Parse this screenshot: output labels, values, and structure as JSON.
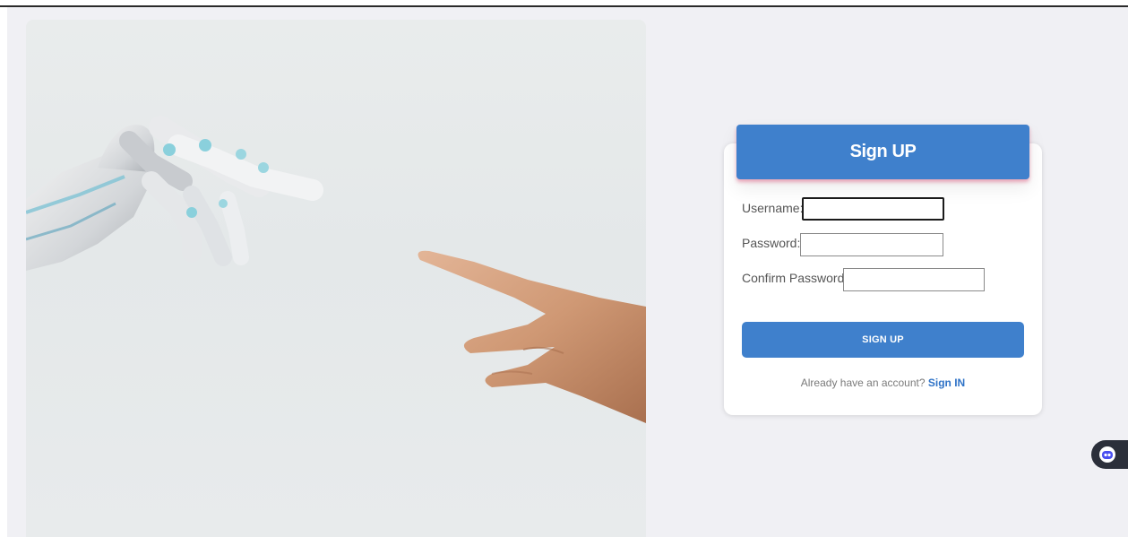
{
  "signup_card": {
    "title": "Sign UP",
    "fields": {
      "username": {
        "label": "Username:",
        "value": ""
      },
      "password": {
        "label": "Password:",
        "value": ""
      },
      "confirm_password": {
        "label": "Confirm Password:",
        "value": ""
      }
    },
    "submit_label": "SIGN UP",
    "footer_text": "Already have an account?",
    "signin_link": "Sign IN"
  },
  "hero_image": {
    "subject": "robot-hand-and-human-hand"
  },
  "assistant_widget": {
    "icon": "assistant-robot-icon"
  },
  "colors": {
    "primary": "#3f80cc",
    "background": "#f0f0f4",
    "card": "#ffffff",
    "link": "#2f73c7"
  }
}
